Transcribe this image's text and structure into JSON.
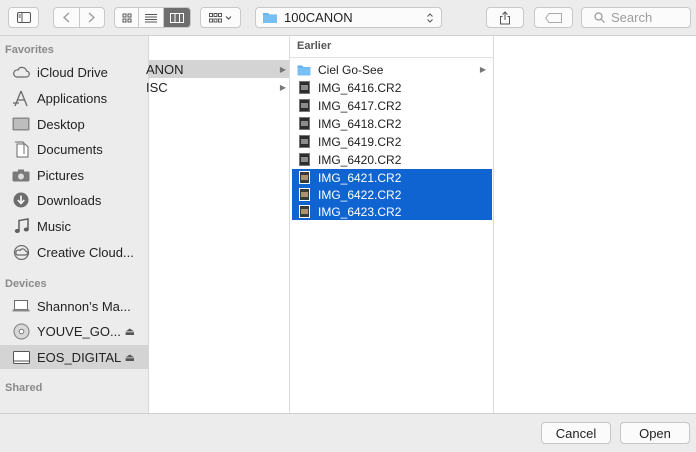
{
  "toolbar": {
    "location": "100CANON",
    "search_placeholder": "Search",
    "icons": [
      "sidebar-toggle-icon",
      "back-icon",
      "forward-icon",
      "icon-view-icon",
      "list-view-icon",
      "column-view-icon",
      "group-icon",
      "share-icon",
      "tag-icon",
      "search-icon"
    ]
  },
  "sidebar": {
    "favorites_header": "Favorites",
    "favorites": [
      {
        "label": "iCloud Drive",
        "icon": "cloud-icon"
      },
      {
        "label": "Applications",
        "icon": "applications-icon"
      },
      {
        "label": "Desktop",
        "icon": "desktop-icon"
      },
      {
        "label": "Documents",
        "icon": "documents-icon"
      },
      {
        "label": "Pictures",
        "icon": "camera-icon"
      },
      {
        "label": "Downloads",
        "icon": "downloads-icon"
      },
      {
        "label": "Music",
        "icon": "music-icon"
      },
      {
        "label": "Creative Cloud...",
        "icon": "creative-cloud-icon"
      }
    ],
    "devices_header": "Devices",
    "devices": [
      {
        "label": "Shannon’s Ma...",
        "icon": "laptop-icon"
      },
      {
        "label": "YOUVE_GO...",
        "icon": "disc-icon",
        "eject": "⏏"
      },
      {
        "label": "EOS_DIGITAL",
        "icon": "drive-icon",
        "eject": "⏏",
        "selected": true
      }
    ],
    "shared_header": "Shared"
  },
  "column1": {
    "items": [
      {
        "label": "ANON",
        "highlight": true
      },
      {
        "label": "ISC",
        "highlight": false
      }
    ]
  },
  "column2": {
    "header": "Earlier",
    "items": [
      {
        "label": "Ciel Go-See",
        "type": "folder"
      },
      {
        "label": "IMG_6416.CR2",
        "type": "file"
      },
      {
        "label": "IMG_6417.CR2",
        "type": "file"
      },
      {
        "label": "IMG_6418.CR2",
        "type": "file"
      },
      {
        "label": "IMG_6419.CR2",
        "type": "file"
      },
      {
        "label": "IMG_6420.CR2",
        "type": "file"
      },
      {
        "label": "IMG_6421.CR2",
        "type": "file",
        "selected": true
      },
      {
        "label": "IMG_6422.CR2",
        "type": "file",
        "selected": true
      },
      {
        "label": "IMG_6423.CR2",
        "type": "file",
        "selected": true
      }
    ]
  },
  "buttons": {
    "cancel": "Cancel",
    "open": "Open"
  },
  "colors": {
    "selection": "#0f64d2",
    "folder": "#6ab4ec",
    "window_bg": "#ececec"
  }
}
